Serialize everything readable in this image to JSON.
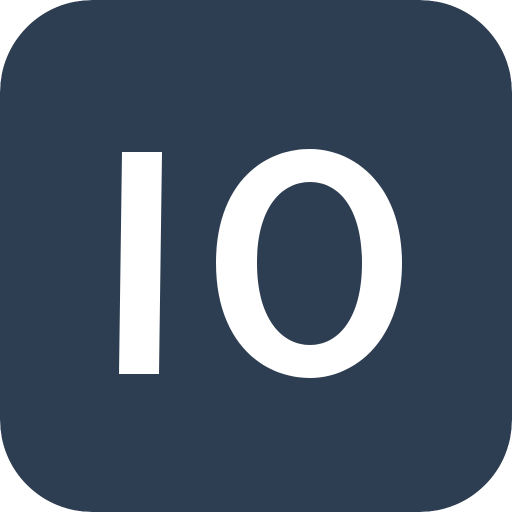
{
  "icon": {
    "name": "io-app-icon",
    "text": "IO",
    "colors": {
      "background": "#2e3e52",
      "foreground": "#ffffff"
    }
  }
}
